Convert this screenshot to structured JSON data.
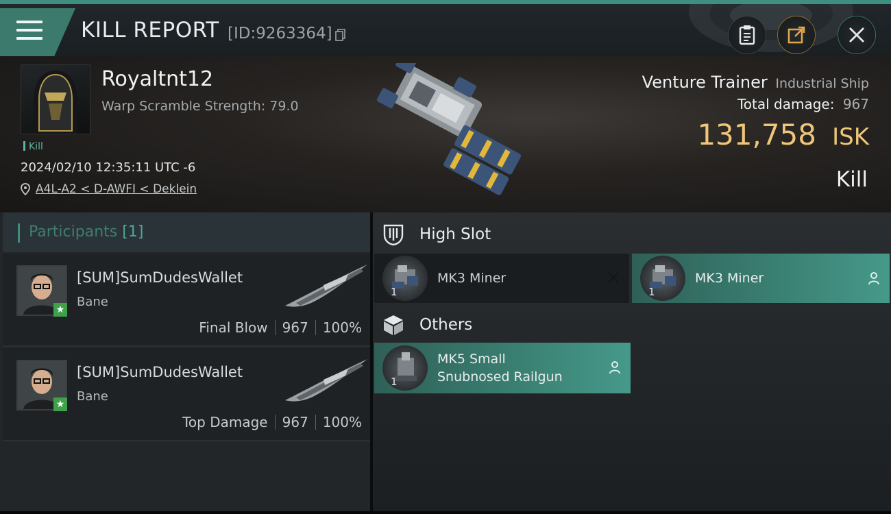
{
  "header": {
    "title": "KILL REPORT",
    "report_id": "[ID:9263364]",
    "accent_color": "#3f8f80"
  },
  "victim": {
    "pilot_name": "Royaltnt12",
    "warp_scramble": "Warp Scramble Strength: 79.0",
    "tag": "Kill",
    "datetime": "2024/02/10 12:35:11 UTC -6",
    "location": "A4L-A2 < D-AWFI < Deklein",
    "ship_name": "Venture Trainer",
    "ship_class": "Industrial Ship",
    "total_damage_label": "Total damage:",
    "total_damage": "967",
    "isk_value": "131,758",
    "isk_unit": "ISK",
    "result": "Kill",
    "isk_color": "#f0c77a"
  },
  "participants": {
    "title": "Participants",
    "count": "[1]",
    "rows": [
      {
        "name": "[SUM]SumDudesWallet",
        "ship": "Bane",
        "role": "Final Blow",
        "damage": "967",
        "percent": "100%"
      },
      {
        "name": "[SUM]SumDudesWallet",
        "ship": "Bane",
        "role": "Top Damage",
        "damage": "967",
        "percent": "100%"
      }
    ]
  },
  "fittings": {
    "high_slot_label": "High Slot",
    "others_label": "Others",
    "high_slot_items": [
      {
        "qty": "1",
        "name": "MK3 Miner",
        "state": "destroyed"
      },
      {
        "qty": "1",
        "name": "MK3 Miner",
        "state": "dropped"
      }
    ],
    "other_items": [
      {
        "qty": "1",
        "name_line1": "MK5 Small",
        "name_line2": "Snubnosed Railgun",
        "state": "dropped"
      }
    ]
  },
  "icons": {
    "menu": "hamburger-icon",
    "copy": "copy-icon",
    "clipboard": "clipboard-icon",
    "share": "share-icon",
    "close": "close-icon",
    "location": "location-pin-icon",
    "high_slot": "high-slot-icon",
    "others": "cube-icon",
    "destroyed": "x-mark-icon",
    "dropped": "person-icon"
  }
}
